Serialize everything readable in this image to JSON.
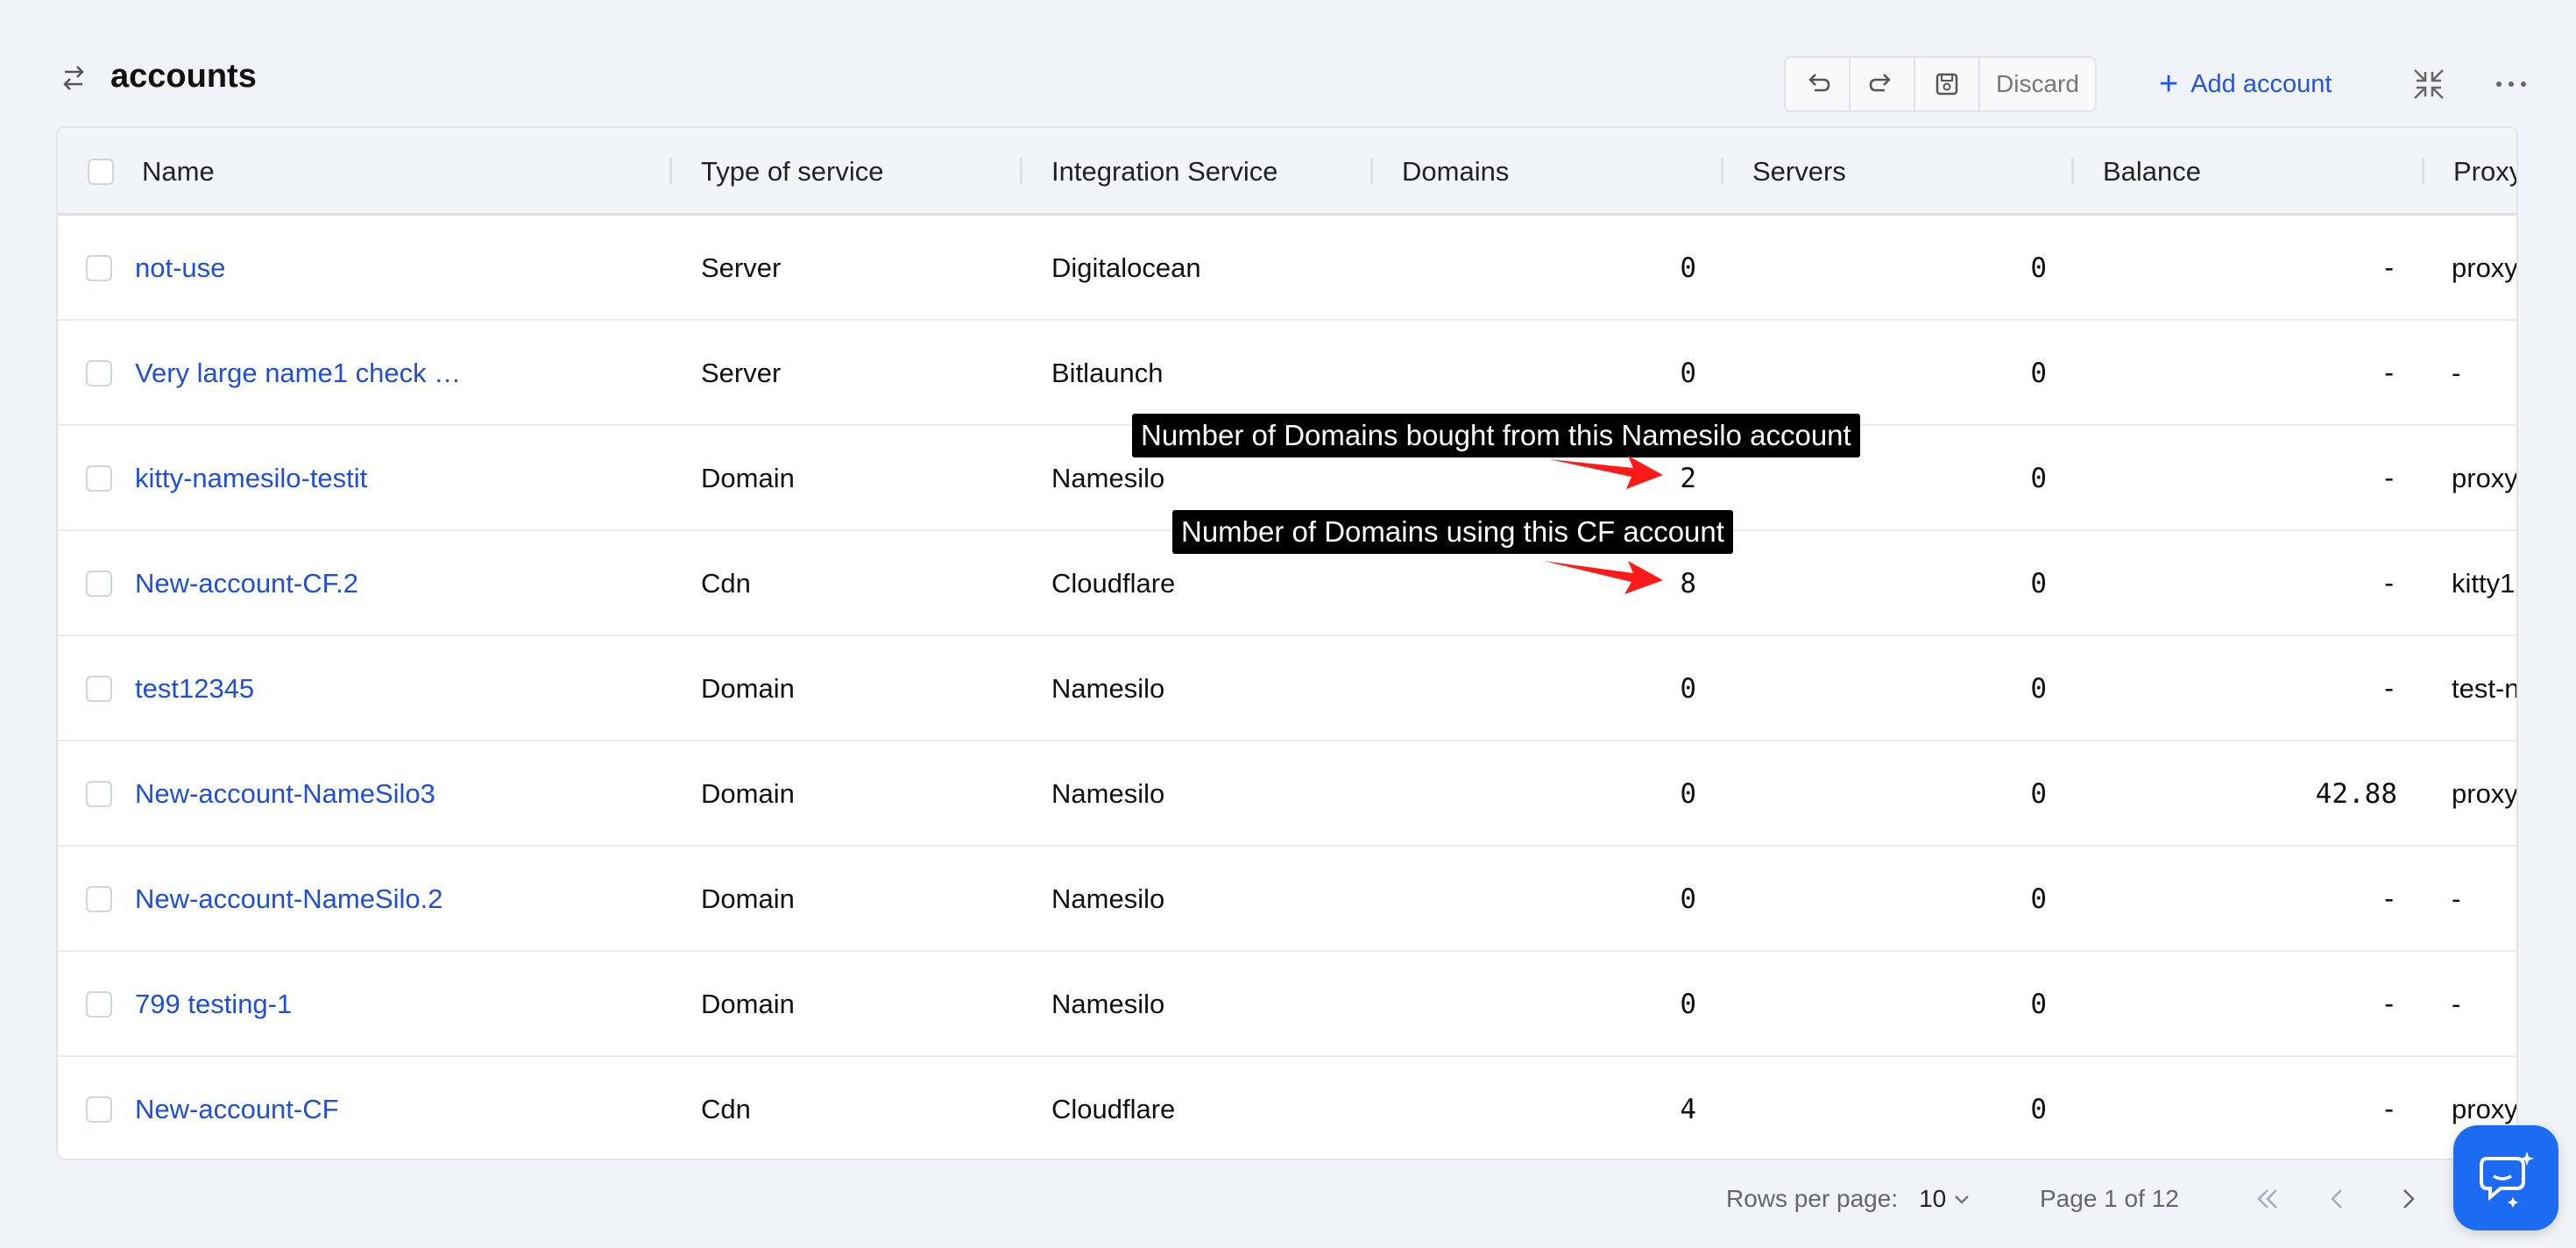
{
  "header": {
    "title": "accounts",
    "title_icon": "arrows-swap-icon",
    "toolbar": {
      "undo_icon": "undo-icon",
      "redo_icon": "redo-icon",
      "save_icon": "save-icon",
      "discard_label": "Discard"
    },
    "add_label": "Add account",
    "add_icon": "plus-icon",
    "collapse_icon": "collapse-icon",
    "more_icon": "more-icon"
  },
  "table": {
    "columns": [
      "Name",
      "Type of service",
      "Integration Service",
      "Domains",
      "Servers",
      "Balance",
      "Proxy"
    ],
    "rows": [
      {
        "name": "not-use",
        "type": "Server",
        "integration": "Digitalocean",
        "domains": "0",
        "servers": "0",
        "balance": "-",
        "proxy": "proxy"
      },
      {
        "name": "Very large name1 check …",
        "type": "Server",
        "integration": "Bitlaunch",
        "domains": "0",
        "servers": "0",
        "balance": "-",
        "proxy": "-"
      },
      {
        "name": "kitty-namesilo-testit",
        "type": "Domain",
        "integration": "Namesilo",
        "domains": "2",
        "servers": "0",
        "balance": "-",
        "proxy": "proxy"
      },
      {
        "name": "New-account-CF.2",
        "type": "Cdn",
        "integration": "Cloudflare",
        "domains": "8",
        "servers": "0",
        "balance": "-",
        "proxy": "kitty1"
      },
      {
        "name": "test12345",
        "type": "Domain",
        "integration": "Namesilo",
        "domains": "0",
        "servers": "0",
        "balance": "-",
        "proxy": "test-n"
      },
      {
        "name": "New-account-NameSilo3",
        "type": "Domain",
        "integration": "Namesilo",
        "domains": "0",
        "servers": "0",
        "balance": "42.88",
        "proxy": "proxy"
      },
      {
        "name": "New-account-NameSilo.2",
        "type": "Domain",
        "integration": "Namesilo",
        "domains": "0",
        "servers": "0",
        "balance": "-",
        "proxy": "-"
      },
      {
        "name": "799 testing-1",
        "type": "Domain",
        "integration": "Namesilo",
        "domains": "0",
        "servers": "0",
        "balance": "-",
        "proxy": "-"
      },
      {
        "name": "New-account-CF",
        "type": "Cdn",
        "integration": "Cloudflare",
        "domains": "4",
        "servers": "0",
        "balance": "-",
        "proxy": "proxy"
      }
    ]
  },
  "annotations": [
    "Number of Domains bought from this Namesilo account",
    "Number of Domains using this CF account"
  ],
  "footer": {
    "rows_per_page_label": "Rows per page:",
    "rows_per_page_value": "10",
    "page_label": "Page 1 of 12"
  },
  "colors": {
    "accent": "#2255e6",
    "link": "#1f4fd6",
    "chat": "#1b6cf2",
    "annotation_arrow": "#ff1a1a"
  }
}
